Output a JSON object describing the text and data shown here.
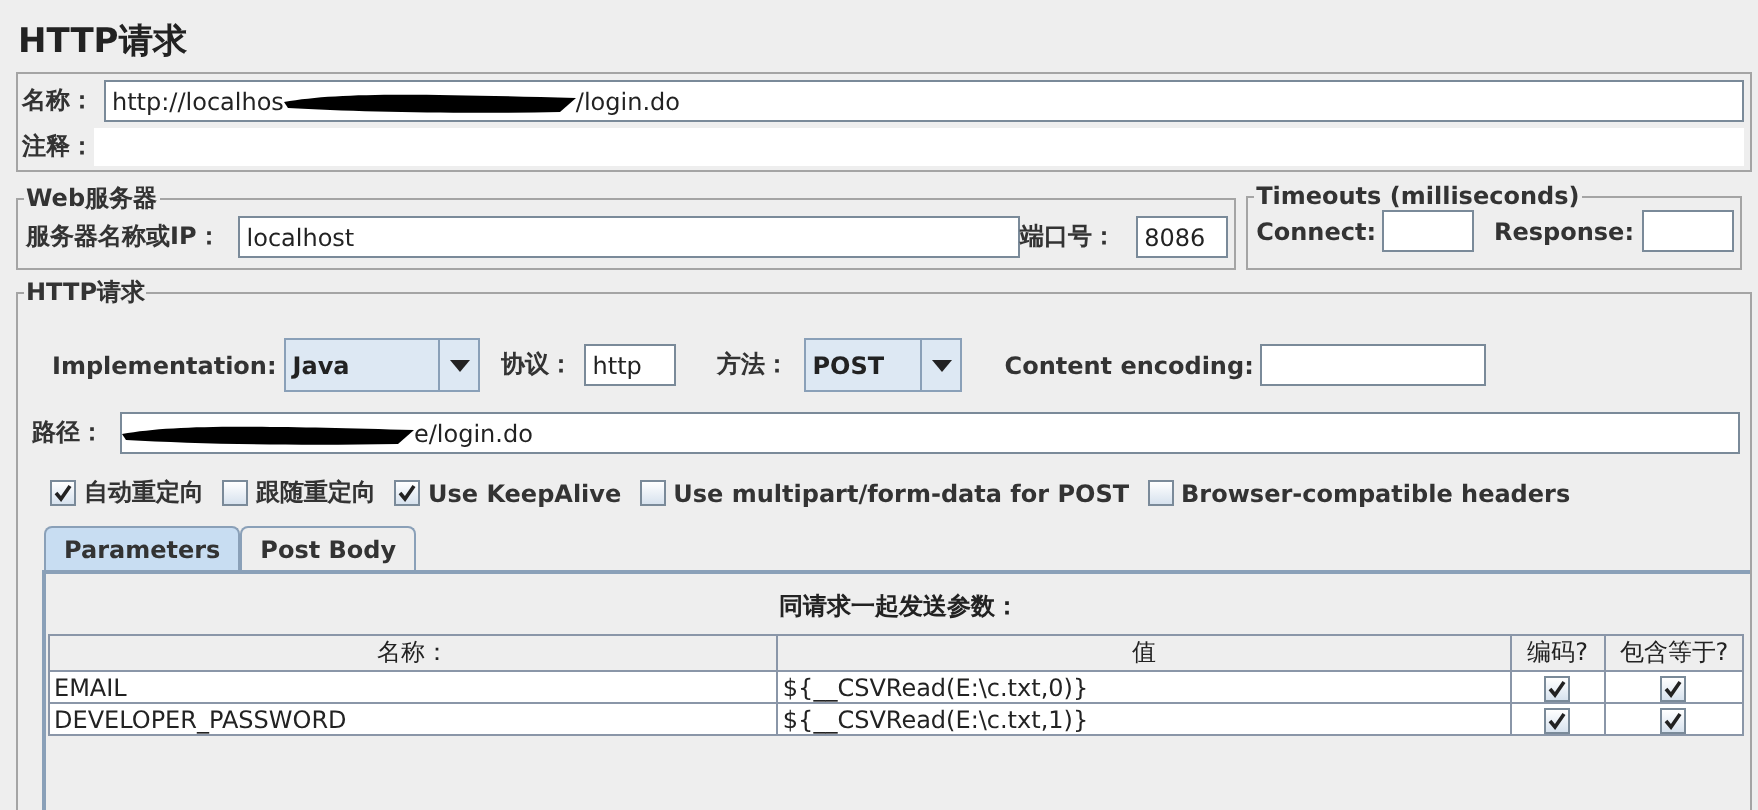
{
  "title": "HTTP请求",
  "name_field": {
    "label": "名称：",
    "segments": [
      {
        "kind": "text",
        "text": "http://localhos"
      },
      {
        "kind": "redaction"
      },
      {
        "kind": "text",
        "text": "/login.do"
      }
    ]
  },
  "comment_field": {
    "label": "注释："
  },
  "web_server": {
    "title": "Web服务器",
    "server_label": "服务器名称或IP：",
    "server_value": "localhost",
    "port_label": "端口号：",
    "port_value": "8086"
  },
  "timeouts": {
    "title": "Timeouts (milliseconds)",
    "connect_label": "Connect:",
    "response_label": "Response:"
  },
  "http_request": {
    "title": "HTTP请求",
    "implementation_label": "Implementation:",
    "implementation_value": "Java",
    "protocol_label": "协议：",
    "protocol_value": "http",
    "method_label": "方法：",
    "method_value": "POST",
    "encoding_label": "Content encoding:",
    "path_label": "路径：",
    "path_segments": [
      {
        "kind": "redaction"
      },
      {
        "kind": "text",
        "text": "e/login.do"
      }
    ],
    "options": [
      {
        "label": "自动重定向",
        "checked": true
      },
      {
        "label": "跟随重定向",
        "checked": false
      },
      {
        "label": "Use KeepAlive",
        "checked": true
      },
      {
        "label": "Use multipart/form-data for POST",
        "checked": false
      },
      {
        "label": "Browser-compatible headers",
        "checked": false
      }
    ]
  },
  "tabs": [
    {
      "label": "Parameters",
      "selected": true
    },
    {
      "label": "Post Body",
      "selected": false
    }
  ],
  "parameters": {
    "title": "同请求一起发送参数：",
    "columns": [
      "名称：",
      "值",
      "编码?",
      "包含等于?"
    ],
    "rows": [
      {
        "name": "EMAIL",
        "value": "${__CSVRead(E:\\c.txt,0)}",
        "encode": true,
        "include_equals": true
      },
      {
        "name": "DEVELOPER_PASSWORD",
        "value": "${__CSVRead(E:\\c.txt,1)}",
        "encode": true,
        "include_equals": true
      }
    ]
  }
}
